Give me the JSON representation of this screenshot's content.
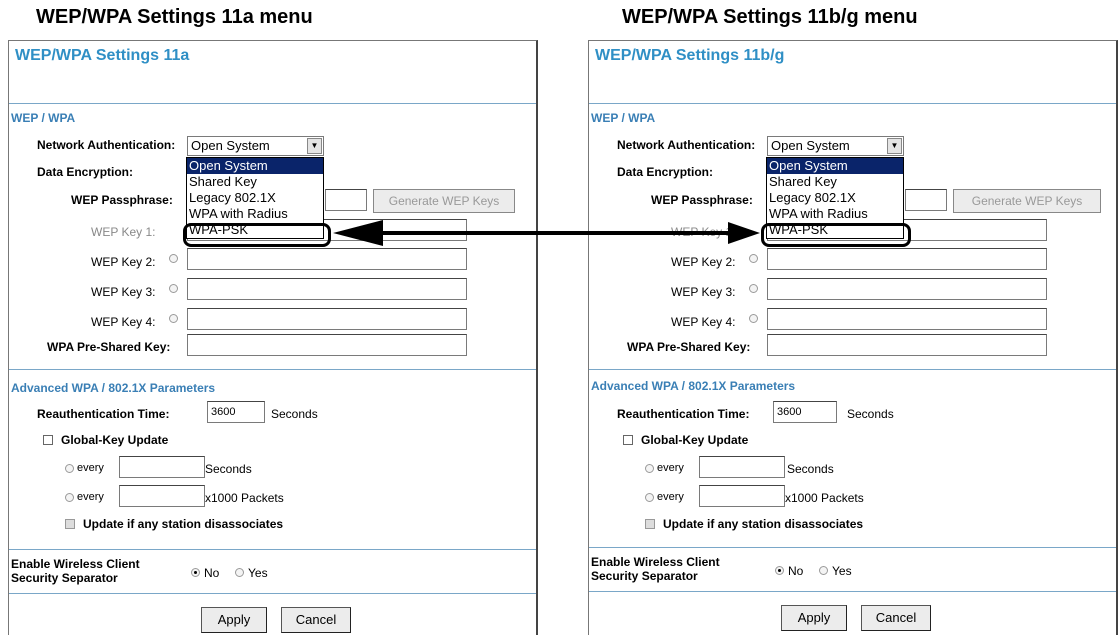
{
  "captions": {
    "left": "WEP/WPA Settings 11a menu",
    "right": "WEP/WPA Settings 11b/g menu"
  },
  "left": {
    "title": "WEP/WPA Settings 11a",
    "section_wep": "WEP / WPA",
    "net_auth_label": "Network Authentication:",
    "net_auth_value": "Open System",
    "auth_options": [
      "Open System",
      "Shared Key",
      "Legacy 802.1X",
      "WPA with Radius",
      "WPA-PSK"
    ],
    "data_enc_label": "Data Encryption:",
    "passphrase_label": "WEP Passphrase:",
    "generate_label": "Generate WEP Keys",
    "key1_label": "WEP Key 1:",
    "key1_occluded": "WEP K",
    "key2_label": "WEP Key 2:",
    "key3_label": "WEP Key 3:",
    "key4_label": "WEP Key 4:",
    "psk_label": "WPA Pre-Shared Key:",
    "section_adv": "Advanced WPA / 802.1X Parameters",
    "reauth_label": "Reauthentication Time:",
    "reauth_value": "3600",
    "seconds_label": "Seconds",
    "global_key_label": "Global-Key Update",
    "every_label": "every",
    "every_seconds_unit": "Seconds",
    "every_packets_unit": "x1000 Packets",
    "update_label": "Update if any station disassociates",
    "sep_label_1": "Enable Wireless Client",
    "sep_label_2": "Security Separator",
    "no_label": "No",
    "yes_label": "Yes",
    "apply_label": "Apply",
    "cancel_label": "Cancel"
  },
  "right": {
    "title": "WEP/WPA Settings 11b/g",
    "section_wep": "WEP / WPA",
    "net_auth_label": "Network Authentication:",
    "net_auth_value": "Open System",
    "auth_options": [
      "Open System",
      "Shared Key",
      "Legacy 802.1X",
      "WPA with Radius",
      "WPA-PSK"
    ],
    "data_enc_label": "Data Encryption:",
    "passphrase_label": "WEP Passphrase:",
    "generate_label": "Generate WEP Keys",
    "key1_label": "WEP Key 1:",
    "key1_occluded": "WEP K",
    "key2_label": "WEP Key 2:",
    "key3_label": "WEP Key 3:",
    "key4_label": "WEP Key 4:",
    "psk_label": "WPA Pre-Shared Key:",
    "section_adv": "Advanced WPA / 802.1X Parameters",
    "reauth_label": "Reauthentication Time:",
    "reauth_value": "3600",
    "seconds_label": "Seconds",
    "global_key_label": "Global-Key Update",
    "every_label": "every",
    "every_seconds_unit": "Seconds",
    "every_packets_unit": "x1000 Packets",
    "update_label": "Update if any station disassociates",
    "sep_label_1": "Enable Wireless Client",
    "sep_label_2": "Security Separator",
    "no_label": "No",
    "yes_label": "Yes",
    "apply_label": "Apply",
    "cancel_label": "Cancel"
  },
  "colors": {
    "title": "#2f8fc5",
    "section": "#3a7fb5",
    "list_selected": "#0a246a"
  }
}
